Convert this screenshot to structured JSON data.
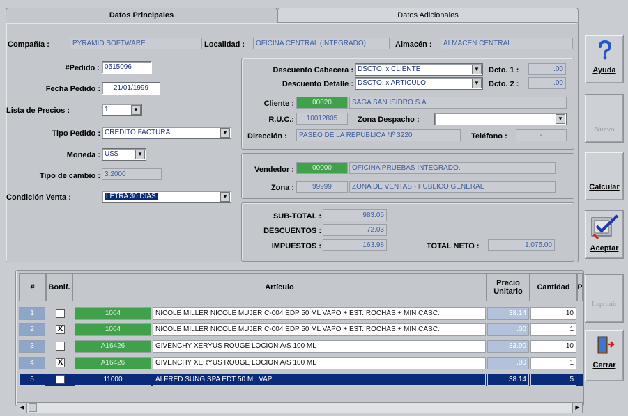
{
  "tabs": {
    "main": "Datos Principales",
    "extra": "Datos Adicionales"
  },
  "header": {
    "compania_label": "Compañía :",
    "compania": "PYRAMID SOFTWARE",
    "localidad_label": "Localidad :",
    "localidad": "OFICINA CENTRAL (INTEGRADO)",
    "almacen_label": "Almacén :",
    "almacen": "ALMACEN CENTRAL"
  },
  "left": {
    "pedido_label": "#Pedido :",
    "pedido": "0515096",
    "fecha_label": "Fecha Pedido :",
    "fecha": "21/01/1999",
    "lista_label": "Lista de Precios :",
    "lista": "1",
    "tipo_label": "Tipo Pedido :",
    "tipo": "CREDITO FACTURA",
    "moneda_label": "Moneda :",
    "moneda": "US$",
    "cambio_label": "Tipo de cambio :",
    "cambio": "3.2000",
    "condicion_label": "Condición Venta :",
    "condicion": "LETRA 30 DIAS"
  },
  "discount": {
    "cabecera_label": "Descuento Cabecera :",
    "cabecera": "DSCTO. x CLIENTE",
    "detalle_label": "Descuento Detalle :",
    "detalle": "DSCTO. x ARTICULO",
    "dcto1_label": "Dcto. 1 :",
    "dcto1": ".00",
    "dcto2_label": "Dcto. 2 :",
    "dcto2": ".00"
  },
  "client": {
    "cliente_label": "Cliente :",
    "cliente_code": "00020",
    "cliente_name": "SAGA SAN ISIDRO S.A.",
    "ruc_label": "R.U.C.:",
    "ruc": "10012805",
    "zona_label": "Zona Despacho :",
    "zona": "",
    "direccion_label": "Dirección :",
    "direccion": "PASEO DE LA REPUBLICA Nº 3220",
    "telefono_label": "Teléfono :",
    "telefono": "-"
  },
  "seller": {
    "vendedor_label": "Vendedor :",
    "vendedor_code": "00000",
    "vendedor_name": "OFICINA PRUEBAS INTEGRADO.",
    "zona_label": "Zona :",
    "zona_code": "99999",
    "zona_name": "ZONA DE VENTAS - PUBLICO GENERAL"
  },
  "totals": {
    "subtotal_label": "SUB-TOTAL :",
    "subtotal": "983.05",
    "descuentos_label": "DESCUENTOS :",
    "descuentos": "72.03",
    "impuestos_label": "IMPUESTOS :",
    "impuestos": "163.98",
    "neto_label": "TOTAL NETO :",
    "neto": "1,075.00"
  },
  "sidebar": {
    "ayuda": "Ayuda",
    "nuevo": "Nuevo",
    "calcular": "Calcular",
    "aceptar": "Aceptar",
    "imprimir": "Imprimir",
    "cerrar": "Cerrar"
  },
  "grid": {
    "headers": {
      "num": "#",
      "bonif": "Bonif.",
      "articulo": "Artículo",
      "precio": "Precio Unitario",
      "cantidad": "Cantidad",
      "extra": "P"
    },
    "rows": [
      {
        "num": "1",
        "bonif": "",
        "code": "1004",
        "desc": "NICOLE MILLER NICOLE MUJER C-004 EDP  50 ML VAPO + EST. ROCHAS + MIN CASC.",
        "precio": "38.14",
        "cantidad": "10"
      },
      {
        "num": "2",
        "bonif": "X",
        "code": "1004",
        "desc": "NICOLE MILLER NICOLE MUJER C-004 EDP  50 ML VAPO + EST. ROCHAS + MIN CASC.",
        "precio": ".00",
        "cantidad": "1"
      },
      {
        "num": "3",
        "bonif": "",
        "code": "A16426",
        "desc": "GIVENCHY XERYUS ROUGE LOCION A/S 100 ML",
        "precio": "33.90",
        "cantidad": "10"
      },
      {
        "num": "4",
        "bonif": "X",
        "code": "A16426",
        "desc": "GIVENCHY XERYUS ROUGE LOCION A/S 100 ML",
        "precio": ".00",
        "cantidad": "1"
      },
      {
        "num": "5",
        "bonif": "",
        "code": "11000",
        "desc": "ALFRED SUNG SPA EDT  50 ML VAP",
        "precio": "38.14",
        "cantidad": "5"
      }
    ]
  },
  "colors": {
    "code_green": "#3fa24a",
    "selection": "#0a2a7a",
    "value_blue": "#3f5f9e"
  },
  "icons": [
    "question-icon",
    "calculator-icon",
    "check-ok-icon",
    "exit-door-icon",
    "scroll-left-icon",
    "scroll-right-icon"
  ]
}
